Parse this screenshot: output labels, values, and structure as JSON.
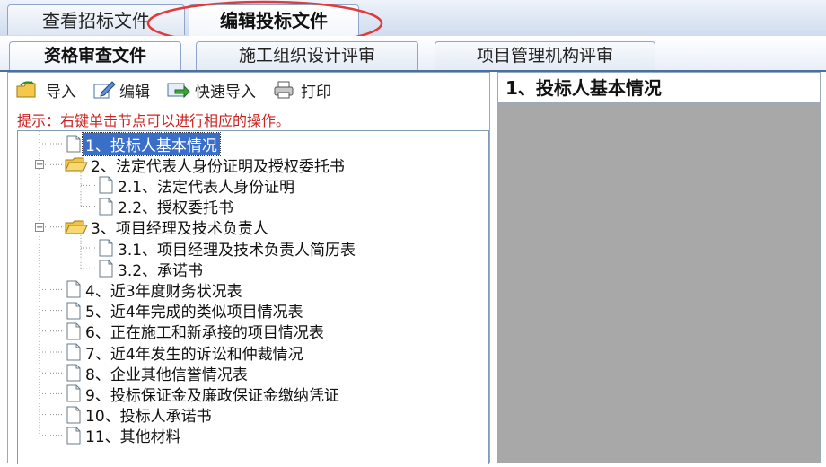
{
  "top_tabs": [
    {
      "label": "查看招标文件"
    },
    {
      "label": "编辑投标文件"
    }
  ],
  "sub_tabs": [
    {
      "label": "资格审查文件"
    },
    {
      "label": "施工组织设计评审"
    },
    {
      "label": "项目管理机构评审"
    }
  ],
  "toolbar": {
    "import_label": "导入",
    "edit_label": "编辑",
    "quick_import_label": "快速导入",
    "print_label": "打印"
  },
  "hint": "提示：右键单击节点可以进行相应的操作。",
  "tree": [
    {
      "label": "1、投标人基本情况",
      "depth": 0,
      "type": "doc",
      "selected": true
    },
    {
      "label": "2、法定代表人身份证明及授权委托书",
      "depth": 0,
      "type": "folder",
      "expanded": true
    },
    {
      "label": "2.1、法定代表人身份证明",
      "depth": 1,
      "type": "doc"
    },
    {
      "label": "2.2、授权委托书",
      "depth": 1,
      "type": "doc"
    },
    {
      "label": "3、项目经理及技术负责人",
      "depth": 0,
      "type": "folder",
      "expanded": true
    },
    {
      "label": "3.1、项目经理及技术负责人简历表",
      "depth": 1,
      "type": "doc"
    },
    {
      "label": "3.2、承诺书",
      "depth": 1,
      "type": "doc"
    },
    {
      "label": "4、近3年度财务状况表",
      "depth": 0,
      "type": "doc"
    },
    {
      "label": "5、近4年完成的类似项目情况表",
      "depth": 0,
      "type": "doc"
    },
    {
      "label": "6、正在施工和新承接的项目情况表",
      "depth": 0,
      "type": "doc"
    },
    {
      "label": "7、近4年发生的诉讼和仲裁情况",
      "depth": 0,
      "type": "doc"
    },
    {
      "label": "8、企业其他信誉情况表",
      "depth": 0,
      "type": "doc"
    },
    {
      "label": "9、投标保证金及廉政保证金缴纳凭证",
      "depth": 0,
      "type": "doc"
    },
    {
      "label": "10、投标人承诺书",
      "depth": 0,
      "type": "doc"
    },
    {
      "label": "11、其他材料",
      "depth": 0,
      "type": "doc"
    }
  ],
  "right_panel": {
    "title": "1、投标人基本情况"
  },
  "colors": {
    "selection": "#3a6fc9",
    "hint_red": "#cc2222",
    "annotation_red": "#e03a3a",
    "content_gray": "#a8a8a8"
  }
}
